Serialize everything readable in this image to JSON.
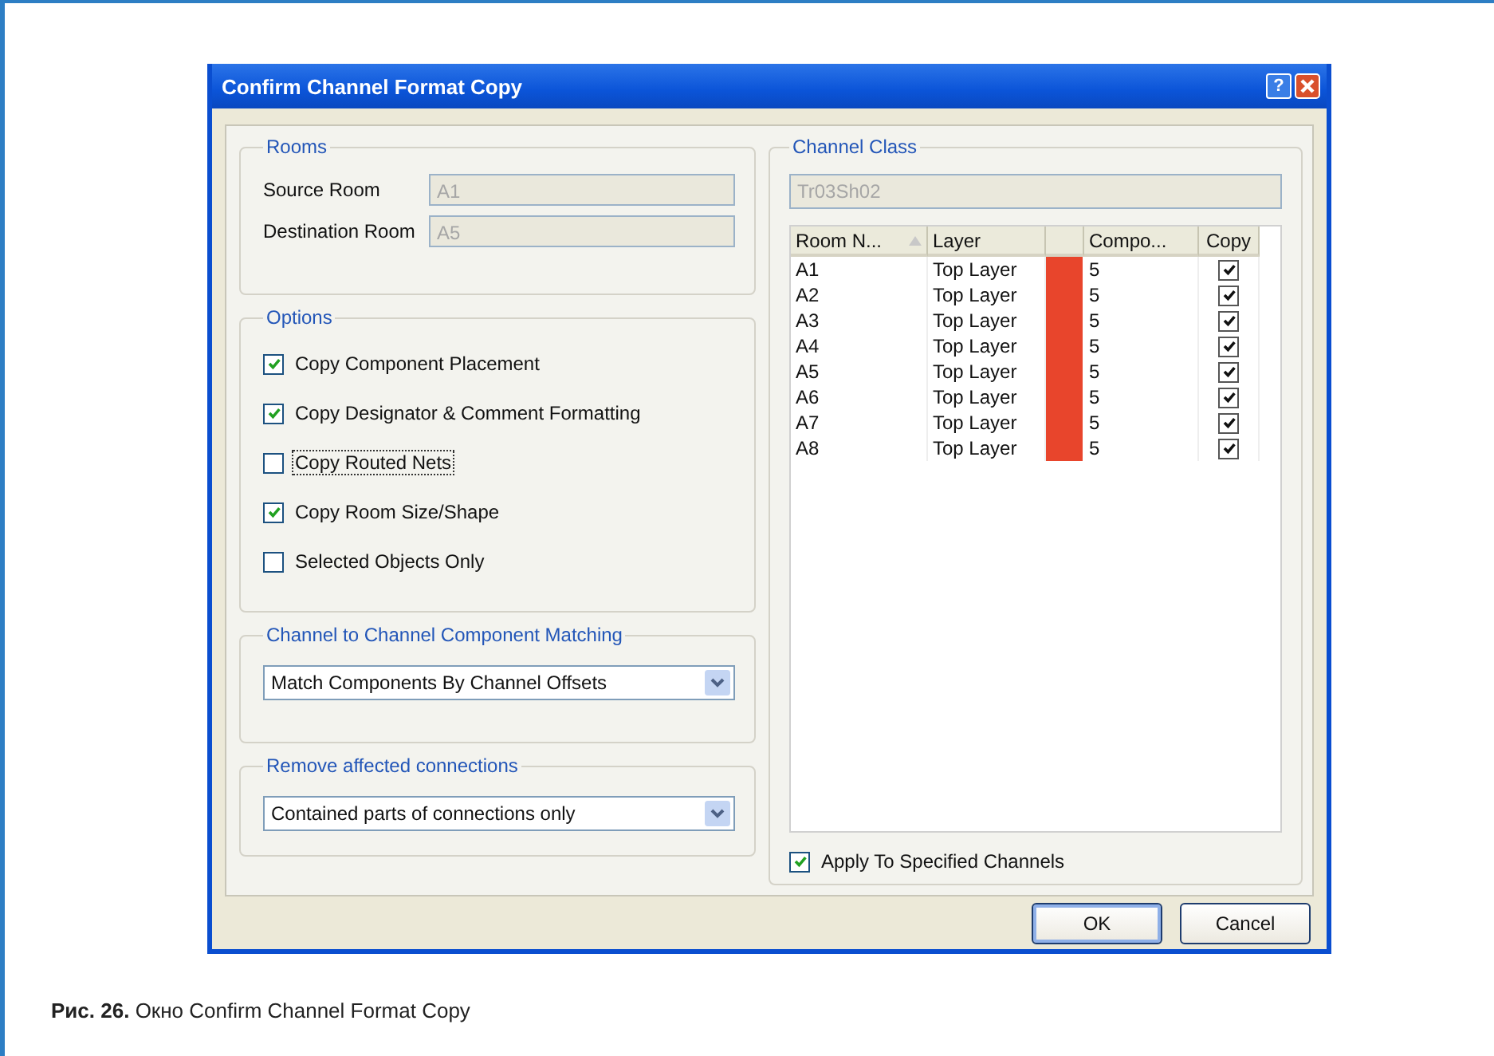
{
  "window": {
    "title": "Confirm Channel Format Copy",
    "help": "?"
  },
  "rooms": {
    "title": "Rooms",
    "fields": [
      {
        "label": "Source Room",
        "value": "A1",
        "disabled": true
      },
      {
        "label": "Destination Room",
        "value": "A5",
        "disabled": true
      }
    ]
  },
  "options": {
    "title": "Options",
    "checkboxes": [
      {
        "label": "Copy Component Placement",
        "checked": true,
        "focused": false
      },
      {
        "label": "Copy Designator & Comment Formatting",
        "checked": true,
        "focused": false
      },
      {
        "label": "Copy Routed Nets",
        "checked": false,
        "focused": true
      },
      {
        "label": "Copy Room Size/Shape",
        "checked": true,
        "focused": false
      },
      {
        "label": "Selected Objects Only",
        "checked": false,
        "focused": false
      }
    ]
  },
  "matching": {
    "title": "Channel to Channel Component Matching",
    "value": "Match Components By Channel Offsets"
  },
  "remove": {
    "title": "Remove affected connections",
    "value": "Contained parts of connections only"
  },
  "channel_class": {
    "title": "Channel Class",
    "field": {
      "value": "Tr03Sh02",
      "disabled": true
    },
    "columns": [
      {
        "label": "Room N...",
        "sorted": true
      },
      {
        "label": "Layer",
        "sorted": false
      },
      {
        "sorted": false
      },
      {
        "label": "Compo...",
        "sorted": false
      },
      {
        "label": "Copy",
        "sorted": false
      }
    ],
    "rows": [
      {
        "room": "A1",
        "layer": "Top Layer",
        "color": "#e8452c",
        "components": "5",
        "copy": true
      },
      {
        "room": "A2",
        "layer": "Top Layer",
        "color": "#e8452c",
        "components": "5",
        "copy": true
      },
      {
        "room": "A3",
        "layer": "Top Layer",
        "color": "#e8452c",
        "components": "5",
        "copy": true
      },
      {
        "room": "A4",
        "layer": "Top Layer",
        "color": "#e8452c",
        "components": "5",
        "copy": true
      },
      {
        "room": "A5",
        "layer": "Top Layer",
        "color": "#e8452c",
        "components": "5",
        "copy": true
      },
      {
        "room": "A6",
        "layer": "Top Layer",
        "color": "#e8452c",
        "components": "5",
        "copy": true
      },
      {
        "room": "A7",
        "layer": "Top Layer",
        "color": "#e8452c",
        "components": "5",
        "copy": true
      },
      {
        "room": "A8",
        "layer": "Top Layer",
        "color": "#e8452c",
        "components": "5",
        "copy": true
      }
    ],
    "apply": {
      "label": "Apply To Specified Channels",
      "checked": true
    }
  },
  "buttons": [
    {
      "label": "OK",
      "default": true
    },
    {
      "label": "Cancel",
      "default": false
    }
  ],
  "caption": "**Рис. 26.** Окно Confirm Channel Format Copy"
}
